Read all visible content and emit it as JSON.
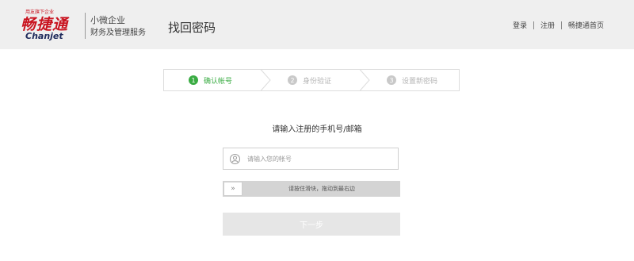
{
  "brand": {
    "tagline": "用友旗下企业",
    "name_cn": "畅捷通",
    "name_en": "Chanjet",
    "slogan_line1": "小微企业",
    "slogan_line2": "财务及管理服务",
    "brand_red": "#c9131f",
    "brand_navy": "#1f2b5c"
  },
  "header": {
    "title": "找回密码",
    "nav": [
      "登录",
      "注册",
      "畅捷通首页"
    ]
  },
  "steps": [
    {
      "number": "1",
      "label": "确认帐号",
      "state": "active"
    },
    {
      "number": "2",
      "label": "身份验证",
      "state": "inactive"
    },
    {
      "number": "3",
      "label": "设置新密码",
      "state": "inactive"
    }
  ],
  "form": {
    "prompt": "请输入注册的手机号/邮箱",
    "account_placeholder": "请输入您的帐号",
    "account_value": "",
    "user_icon": "user-icon",
    "slider_handle_glyph": "»",
    "slider_text": "请按住滑块，拖动到最右边",
    "next_label": "下一步"
  },
  "colors": {
    "active_green": "#3aac43",
    "inactive_gray": "#c9c9c9",
    "header_bg": "#efefef"
  }
}
